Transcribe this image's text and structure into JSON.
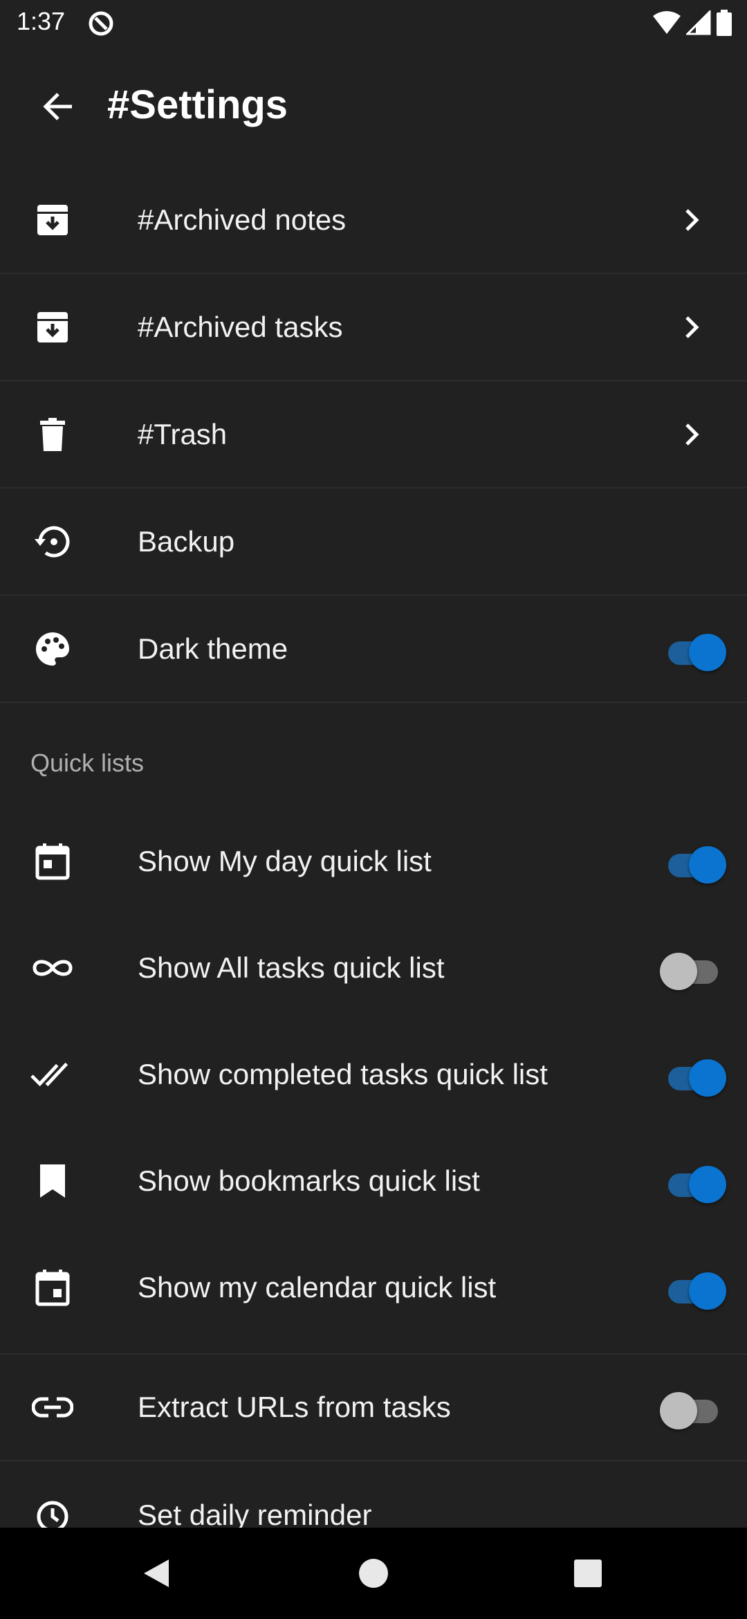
{
  "status_bar": {
    "time": "1:37"
  },
  "app_bar": {
    "title": "#Settings"
  },
  "menu": [
    {
      "label": "#Archived notes",
      "icon": "archive-icon"
    },
    {
      "label": "#Archived tasks",
      "icon": "archive-icon"
    },
    {
      "label": "#Trash",
      "icon": "trash-icon"
    },
    {
      "label": "Backup",
      "icon": "backup-restore-icon"
    },
    {
      "label": "Dark theme",
      "icon": "palette-icon",
      "toggle": true
    }
  ],
  "quick_lists": {
    "header": "Quick lists",
    "items": [
      {
        "label": "Show My day quick list",
        "icon": "calendar-today-icon",
        "toggle": true
      },
      {
        "label": "Show All tasks quick list",
        "icon": "infinity-icon",
        "toggle": false
      },
      {
        "label": "Show completed tasks quick list",
        "icon": "double-check-icon",
        "toggle": true
      },
      {
        "label": "Show bookmarks quick list",
        "icon": "bookmark-icon",
        "toggle": true
      },
      {
        "label": "Show my calendar quick list",
        "icon": "calendar-event-icon",
        "toggle": true
      }
    ]
  },
  "other": [
    {
      "label": "Extract URLs from tasks",
      "icon": "link-icon",
      "toggle": false
    },
    {
      "label": "Set daily reminder",
      "icon": "alarm-icon"
    }
  ],
  "colors": {
    "background": "#212121",
    "accent": "#0a74d0",
    "divider": "#2c2c2c"
  }
}
